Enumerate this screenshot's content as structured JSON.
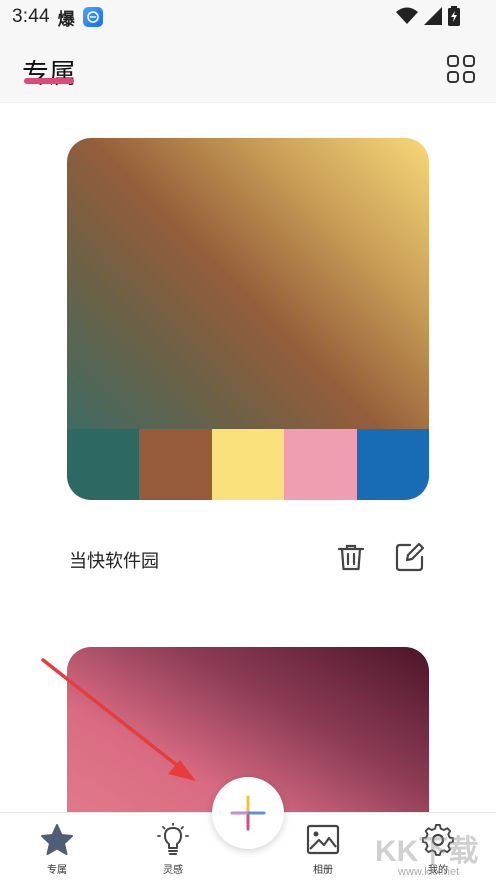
{
  "status_bar": {
    "time": "3:44",
    "notification_glyph": "爆",
    "icons": [
      "wifi-icon",
      "signal-icon",
      "battery-icon"
    ]
  },
  "header": {
    "title": "专属",
    "accent_color": "#e0487e",
    "grid_icon": "grid-icon"
  },
  "palettes": [
    {
      "name": "当快软件园",
      "colors": [
        "#2e6862",
        "#955b3b",
        "#f9e07a",
        "#ee9eb0",
        "#176cb5"
      ],
      "actions": [
        "trash-icon",
        "edit-icon"
      ]
    }
  ],
  "fab": {
    "icon": "plus-icon"
  },
  "bottom_nav": [
    {
      "label": "专属",
      "icon": "star-icon"
    },
    {
      "label": "灵感",
      "icon": "bulb-icon"
    },
    {
      "label": "相册",
      "icon": "image-icon"
    },
    {
      "label": "我的",
      "icon": "gear-icon"
    }
  ],
  "watermark": {
    "text": "KK下载",
    "url": "www.kkx.net"
  }
}
